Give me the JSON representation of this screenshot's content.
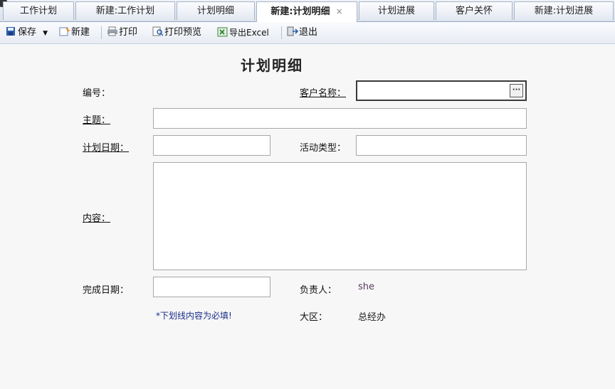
{
  "tabs": [
    {
      "label": "工作计划"
    },
    {
      "label": "新建:工作计划"
    },
    {
      "label": "计划明细"
    },
    {
      "label": "新建:计划明细",
      "close": "×"
    },
    {
      "label": "计划进展"
    },
    {
      "label": "客户关怀"
    },
    {
      "label": "新建:计划进展"
    }
  ],
  "toolbar": {
    "save": "保存",
    "new": "新建",
    "print": "打印",
    "print_preview": "打印预览",
    "export": "导出Excel",
    "exit": "退出"
  },
  "form": {
    "title": "计划明细",
    "id_label": "编号：",
    "customer_label": "客户名称：",
    "customer_btn": "···",
    "subject_label": "主题：",
    "plan_date_label": "计划日期：",
    "activity_type_label": "活动类型：",
    "content_label": "内容：",
    "done_date_label": "完成日期：",
    "owner_label": "负责人：",
    "owner_value": "she",
    "note": "*下划线内容为必填!",
    "region_label": "大区：",
    "region_value": "总经办"
  },
  "colors": {
    "note": "#1a2d8a",
    "owner_value": "#5a3a5a"
  }
}
